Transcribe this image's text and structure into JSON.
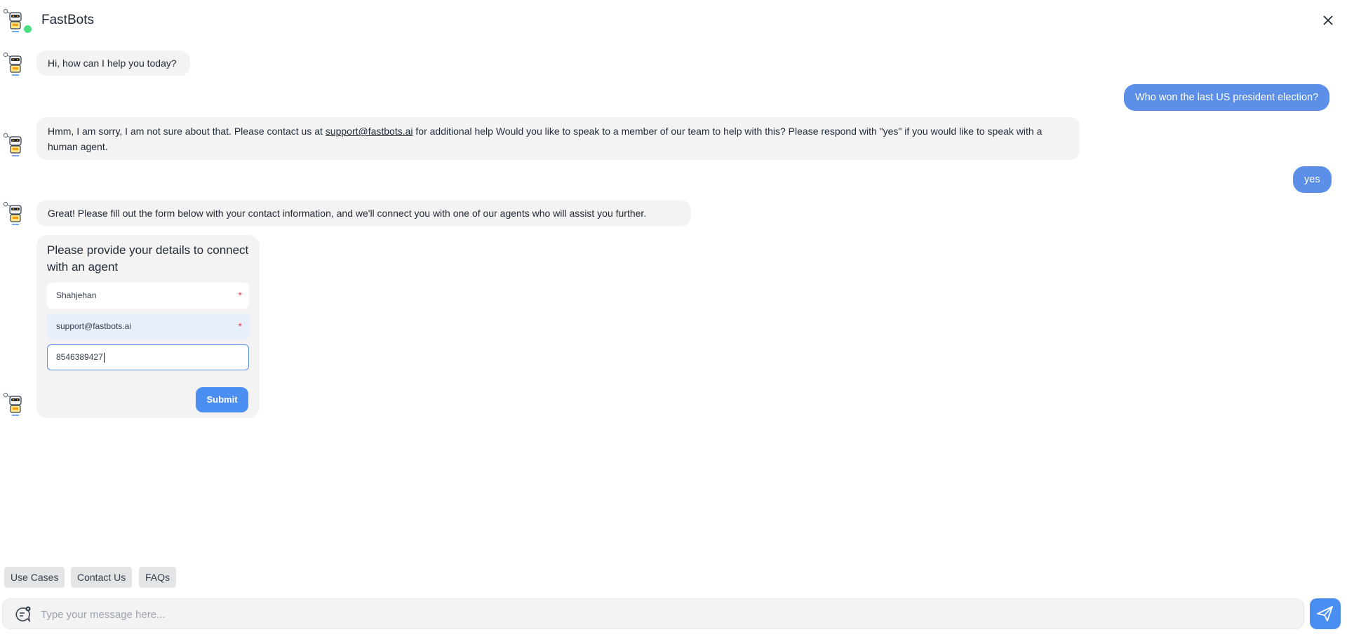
{
  "header": {
    "title": "FastBots"
  },
  "messages": {
    "m1": "Hi, how can I help you today?",
    "m2": "Who won the last US president election?",
    "m3_before": "Hmm, I am sorry, I am not sure about that. Please contact us at ",
    "m3_link": "support@fastbots.ai",
    "m3_after": " for additional help Would you like to speak to a member of our team to help with this? Please respond with \"yes\" if you would like to speak with a human agent.",
    "m4": "yes",
    "m5": "Great! Please fill out the form below with your contact information, and we'll connect you with one of our agents who will assist you further."
  },
  "form": {
    "title": "Please provide your details to connect with an agent",
    "name_value": "Shahjehan",
    "email_value": "support@fastbots.ai",
    "phone_value": "8546389427",
    "required_mark": "*",
    "submit_label": "Submit"
  },
  "quick_replies": [
    "Use Cases",
    "Contact Us",
    "FAQs"
  ],
  "composer": {
    "placeholder": "Type your message here..."
  },
  "colors": {
    "accent": "#4b8ef2",
    "user_bubble": "#5b8fe8",
    "bot_bubble": "#f3f3f4",
    "online": "#4ade80"
  },
  "icons": {
    "bot_avatar": "robot-avatar-icon",
    "close": "close-icon",
    "emoji": "emoji-chat-icon",
    "send": "send-icon"
  }
}
